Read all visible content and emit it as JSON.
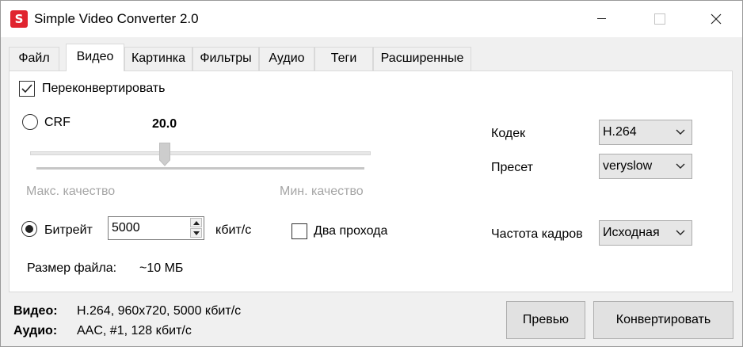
{
  "window": {
    "title": "Simple Video Converter 2.0",
    "icon_letter": "S",
    "brand_color": "#e0242f"
  },
  "tabs": [
    {
      "label": "Файл",
      "active": false
    },
    {
      "label": "Видео",
      "active": true
    },
    {
      "label": "Картинка",
      "active": false
    },
    {
      "label": "Фильтры",
      "active": false
    },
    {
      "label": "Аудио",
      "active": false
    },
    {
      "label": "Теги",
      "active": false
    },
    {
      "label": "Расширенные",
      "active": false
    }
  ],
  "video": {
    "reconvert_label": "Переконвертировать",
    "reconvert_checked": true,
    "crf_label": "CRF",
    "crf_selected": false,
    "crf_value": "20.0",
    "crf_min_label": "Макс. качество",
    "crf_max_label": "Мин. качество",
    "bitrate_label": "Битрейт",
    "bitrate_selected": true,
    "bitrate_value": "5000",
    "bitrate_unit": "кбит/с",
    "two_pass_label": "Два прохода",
    "two_pass_checked": false,
    "file_size_label": "Размер файла:",
    "file_size_value": "~10 МБ",
    "codec_label": "Кодек",
    "codec_value": "H.264",
    "preset_label": "Пресет",
    "preset_value": "veryslow",
    "framerate_label": "Частота кадров",
    "framerate_value": "Исходная"
  },
  "status": {
    "video_label": "Видео:",
    "video_value": "H.264, 960x720, 5000 кбит/с",
    "audio_label": "Аудио:",
    "audio_value": "AAC, #1, 128 кбит/с"
  },
  "buttons": {
    "preview_label": "Превью",
    "convert_label": "Конвертировать"
  }
}
